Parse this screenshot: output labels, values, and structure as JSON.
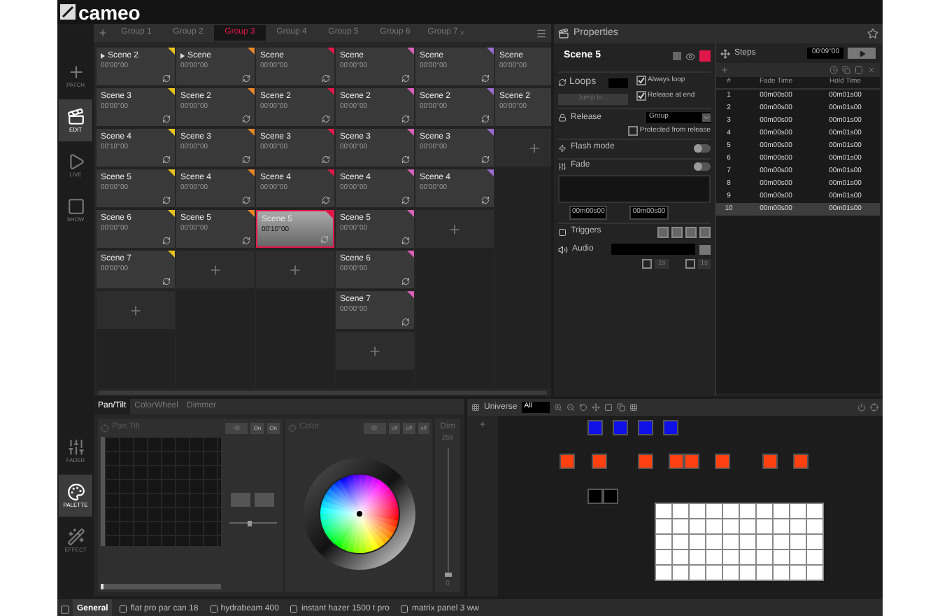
{
  "header": {
    "logo": "cameo"
  },
  "nav_top": [
    {
      "label": "PATCH",
      "selected": false
    },
    {
      "label": "EDIT",
      "selected": true
    },
    {
      "label": "LIVE",
      "selected": false
    },
    {
      "label": "SHOW",
      "selected": false
    }
  ],
  "scene_groups": {
    "tabs": [
      {
        "label": "Group 1",
        "selected": false,
        "closable": false
      },
      {
        "label": "Group 2",
        "selected": false,
        "closable": false
      },
      {
        "label": "Group 3",
        "selected": true,
        "closable": false
      },
      {
        "label": "Group 4",
        "selected": false,
        "closable": false
      },
      {
        "label": "Group 5",
        "selected": false,
        "closable": false
      },
      {
        "label": "Group 6",
        "selected": false,
        "closable": false
      },
      {
        "label": "Group 7",
        "selected": false,
        "closable": true
      }
    ],
    "columns": [
      {
        "color": "#e8c41c",
        "scenes": [
          {
            "name": "Scene 2",
            "time": "00'00''00",
            "playing": true,
            "selected": false
          },
          {
            "name": "Scene 3",
            "time": "00'00''00",
            "playing": false,
            "selected": false
          },
          {
            "name": "Scene 4",
            "time": "00'18''00",
            "playing": false,
            "selected": false
          },
          {
            "name": "Scene 5",
            "time": "00'00''00",
            "playing": false,
            "selected": false
          },
          {
            "name": "Scene 6",
            "time": "00'00''00",
            "playing": false,
            "selected": false
          },
          {
            "name": "Scene 7",
            "time": "00'00''00",
            "playing": false,
            "selected": false
          }
        ]
      },
      {
        "color": "#e8862a",
        "scenes": [
          {
            "name": "Scene",
            "time": "00'00''00",
            "playing": true,
            "selected": false
          },
          {
            "name": "Scene 2",
            "time": "00'00''00",
            "playing": false,
            "selected": false
          },
          {
            "name": "Scene 3",
            "time": "00'00''00",
            "playing": false,
            "selected": false
          },
          {
            "name": "Scene 4",
            "time": "00'00''00",
            "playing": false,
            "selected": false
          },
          {
            "name": "Scene 5",
            "time": "00'00''00",
            "playing": false,
            "selected": false
          }
        ]
      },
      {
        "color": "#e0174a",
        "scenes": [
          {
            "name": "Scene",
            "time": "00'00''00",
            "playing": false,
            "selected": false
          },
          {
            "name": "Scene 2",
            "time": "00'00''00",
            "playing": false,
            "selected": false
          },
          {
            "name": "Scene 3",
            "time": "00'00''00",
            "playing": false,
            "selected": false
          },
          {
            "name": "Scene 4",
            "time": "00'00''00",
            "playing": false,
            "selected": false
          },
          {
            "name": "Scene 5",
            "time": "00'10''00",
            "playing": false,
            "selected": true
          }
        ]
      },
      {
        "color": "#d95fb8",
        "scenes": [
          {
            "name": "Scene",
            "time": "00'00''00",
            "playing": false,
            "selected": false
          },
          {
            "name": "Scene 2",
            "time": "00'00''00",
            "playing": false,
            "selected": false
          },
          {
            "name": "Scene 3",
            "time": "00'00''00",
            "playing": false,
            "selected": false
          },
          {
            "name": "Scene 4",
            "time": "00'00''00",
            "playing": false,
            "selected": false
          },
          {
            "name": "Scene 5",
            "time": "00'00''00",
            "playing": false,
            "selected": false
          },
          {
            "name": "Scene 6",
            "time": "00'00''00",
            "playing": false,
            "selected": false
          },
          {
            "name": "Scene 7",
            "time": "00'00''00",
            "playing": false,
            "selected": false
          }
        ]
      },
      {
        "color": "#9a6ad0",
        "scenes": [
          {
            "name": "Scene",
            "time": "00'00''00",
            "playing": false,
            "selected": false
          },
          {
            "name": "Scene 2",
            "time": "00'00''00",
            "playing": false,
            "selected": false
          },
          {
            "name": "Scene 3",
            "time": "00'00''00",
            "playing": false,
            "selected": false
          },
          {
            "name": "Scene 4",
            "time": "00'00''00",
            "playing": false,
            "selected": false
          }
        ]
      },
      {
        "scenes": [
          {
            "name": "Scene",
            "time": "00'00''00",
            "playing": false,
            "selected": false
          },
          {
            "name": "Scene 2",
            "time": "00'00''00",
            "playing": false,
            "selected": false
          }
        ]
      }
    ]
  },
  "properties": {
    "title": "Properties",
    "scene": {
      "name": "Scene 5",
      "color": "#e0174a"
    },
    "loops": {
      "label": "Loops",
      "jump_button": "Jump to...",
      "always_loop": {
        "label": "Always loop",
        "checked": true
      },
      "release_at_end": {
        "label": "Release at end",
        "checked": true
      }
    },
    "release": {
      "label": "Release",
      "value": "Group",
      "protected": {
        "label": "Protected from release",
        "checked": false
      }
    },
    "flash_mode": {
      "label": "Flash mode",
      "on": false
    },
    "fade": {
      "label": "Fade",
      "on": false,
      "fade_in": "00m00s00",
      "fade_out": "00m00s00"
    },
    "triggers": {
      "label": "Triggers"
    },
    "audio": {
      "label": "Audio",
      "fade_in": {
        "checked": false,
        "placeholder": "1s"
      },
      "fade_out": {
        "checked": false,
        "placeholder": "1s"
      }
    },
    "steps": {
      "label": "Steps",
      "total": "00'09''00",
      "columns": [
        "#",
        "Fade Time",
        "Hold Time"
      ],
      "rows": [
        {
          "index": "1",
          "fade": "00m00s00",
          "hold": "00m01s00",
          "selected": false
        },
        {
          "index": "2",
          "fade": "00m00s00",
          "hold": "00m01s00",
          "selected": false
        },
        {
          "index": "3",
          "fade": "00m00s00",
          "hold": "00m01s00",
          "selected": false
        },
        {
          "index": "4",
          "fade": "00m00s00",
          "hold": "00m01s00",
          "selected": false
        },
        {
          "index": "5",
          "fade": "00m00s00",
          "hold": "00m01s00",
          "selected": false
        },
        {
          "index": "6",
          "fade": "00m00s00",
          "hold": "00m01s00",
          "selected": false
        },
        {
          "index": "7",
          "fade": "00m00s00",
          "hold": "00m01s00",
          "selected": false
        },
        {
          "index": "8",
          "fade": "00m00s00",
          "hold": "00m01s00",
          "selected": false
        },
        {
          "index": "9",
          "fade": "00m00s00",
          "hold": "00m01s00",
          "selected": false
        },
        {
          "index": "10",
          "fade": "00m00s00",
          "hold": "00m01s00",
          "selected": true
        }
      ]
    }
  },
  "nav_bottom": [
    {
      "label": "FADER",
      "selected": false
    },
    {
      "label": "PALETTE",
      "selected": true
    },
    {
      "label": "EFFECT",
      "selected": false
    }
  ],
  "palette": {
    "tabs": [
      {
        "label": "Pan/Tilt",
        "selected": true
      },
      {
        "label": "ColorWheel",
        "selected": false
      },
      {
        "label": "Dimmer",
        "selected": false
      }
    ],
    "pan_tilt": {
      "title": "Pan Tilt",
      "buttons": [
        "On",
        "On"
      ],
      "speed": {
        "level": 0.45
      },
      "pan": {
        "level": 0
      }
    },
    "color": {
      "title": "Color",
      "buttons": [
        "off",
        "off",
        "off"
      ]
    },
    "dimmer": {
      "title": "Dim",
      "max": "255",
      "min": "0",
      "level": 0
    }
  },
  "universe": {
    "label": "Universe",
    "selector": "All"
  },
  "status_bar": {
    "tabs": [
      {
        "label": "General",
        "selected": true
      },
      {
        "label": "flat pro par can 18",
        "selected": false
      },
      {
        "label": "hydrabeam 400",
        "selected": false
      },
      {
        "label": "instant hazer 1500 t pro",
        "selected": false
      },
      {
        "label": "matrix panel 3 ww",
        "selected": false
      }
    ]
  }
}
